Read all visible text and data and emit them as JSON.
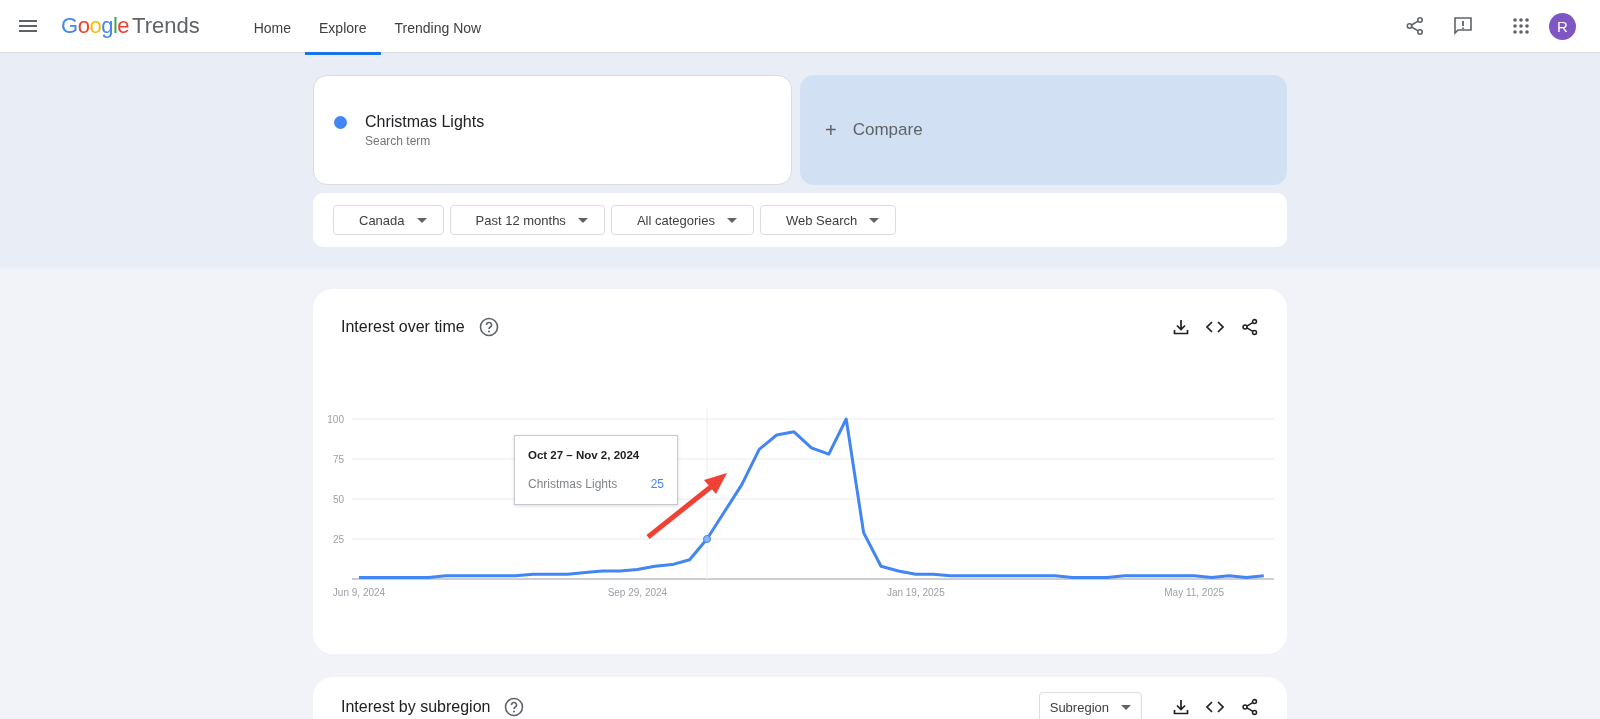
{
  "header": {
    "logo": {
      "first": "Google",
      "second": "Trends"
    },
    "nav": [
      {
        "label": "Home",
        "selected": false
      },
      {
        "label": "Explore",
        "selected": true
      },
      {
        "label": "Trending Now",
        "selected": false
      }
    ],
    "avatar": "R"
  },
  "search": {
    "term": "Christmas Lights",
    "subtitle": "Search term",
    "color": "#4285f4",
    "compare_icon": "+",
    "compare": "Compare"
  },
  "filters": [
    "Canada",
    "Past 12 months",
    "All categories",
    "Web Search"
  ],
  "interest_over_time": {
    "title": "Interest over time",
    "tooltip": {
      "date": "Oct 27 – Nov 2, 2024",
      "value": "25"
    },
    "chart_data": {
      "type": "line",
      "categories": [
        "Jun 9, 2024",
        null,
        null,
        null,
        null,
        null,
        null,
        null,
        null,
        null,
        null,
        null,
        null,
        null,
        null,
        null,
        "Sep 29, 2024",
        null,
        null,
        null,
        null,
        null,
        null,
        null,
        null,
        null,
        null,
        null,
        null,
        null,
        null,
        null,
        "Jan 19, 2025",
        null,
        null,
        null,
        null,
        null,
        null,
        null,
        null,
        null,
        null,
        null,
        null,
        null,
        null,
        null,
        "May 11, 2025",
        null,
        null,
        null,
        null
      ],
      "series": [
        {
          "name": "Christmas Lights",
          "color": "#4285f4",
          "values": [
            1,
            1,
            1,
            1,
            1,
            2,
            2,
            2,
            2,
            2,
            3,
            3,
            3,
            4,
            5,
            5,
            6,
            8,
            9,
            12,
            25,
            42,
            59,
            81,
            90,
            92,
            82,
            78,
            100,
            29,
            8,
            5,
            3,
            3,
            2,
            2,
            2,
            2,
            2,
            2,
            2,
            1,
            1,
            1,
            2,
            2,
            2,
            2,
            2,
            1,
            2,
            1,
            2
          ]
        }
      ],
      "ylim": [
        0,
        100
      ],
      "yticks": [
        25,
        50,
        75,
        100
      ],
      "grid": true
    }
  },
  "interest_by_subregion": {
    "title": "Interest by subregion",
    "dropdown": "Subregion"
  }
}
